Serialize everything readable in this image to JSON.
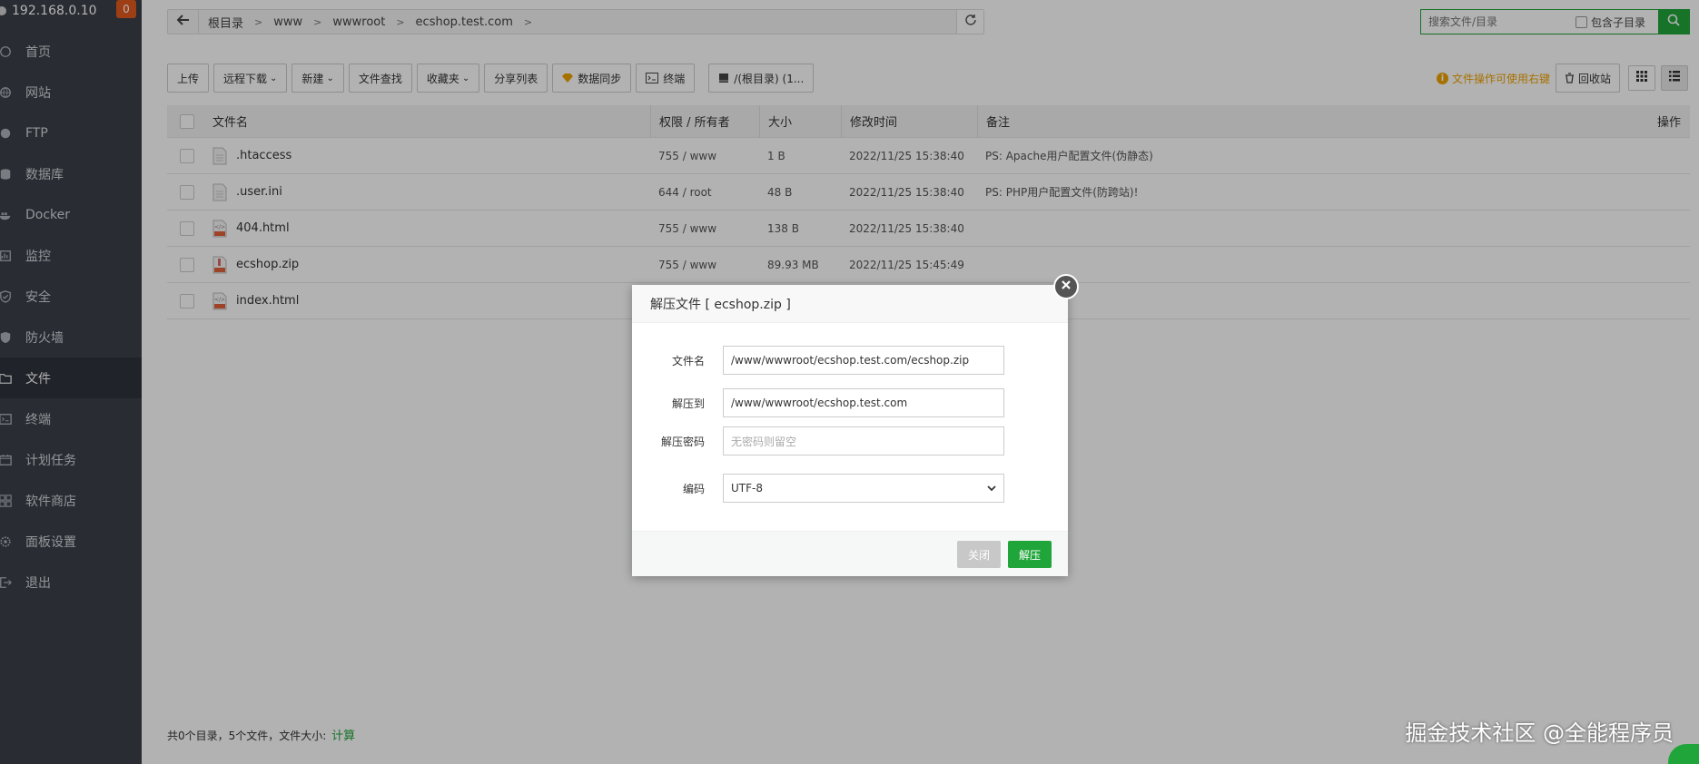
{
  "sidebar": {
    "host": "192.168.0.10",
    "badge": "0",
    "items": [
      {
        "label": "首页",
        "icon": "home-icon"
      },
      {
        "label": "网站",
        "icon": "globe-icon"
      },
      {
        "label": "FTP",
        "icon": "ftp-icon"
      },
      {
        "label": "数据库",
        "icon": "database-icon"
      },
      {
        "label": "Docker",
        "icon": "docker-icon"
      },
      {
        "label": "监控",
        "icon": "monitor-icon"
      },
      {
        "label": "安全",
        "icon": "shield-icon"
      },
      {
        "label": "防火墙",
        "icon": "firewall-icon"
      },
      {
        "label": "文件",
        "icon": "folder-icon",
        "active": true
      },
      {
        "label": "终端",
        "icon": "terminal-icon"
      },
      {
        "label": "计划任务",
        "icon": "calendar-icon"
      },
      {
        "label": "软件商店",
        "icon": "grid-icon"
      },
      {
        "label": "面板设置",
        "icon": "gear-icon"
      },
      {
        "label": "退出",
        "icon": "logout-icon"
      }
    ]
  },
  "path": {
    "crumbs": [
      "根目录",
      "www",
      "wwwroot",
      "ecshop.test.com"
    ]
  },
  "search": {
    "placeholder": "搜索文件/目录",
    "include_sub": "包含子目录"
  },
  "toolbar": {
    "upload": "上传",
    "remote_download": "远程下载",
    "new": "新建",
    "find": "文件查找",
    "favorites": "收藏夹",
    "share_list": "分享列表",
    "sync": "数据同步",
    "terminal": "终端",
    "root_path": "/(根目录) (1..."
  },
  "tip": "文件操作可使用右键",
  "recycle": "回收站",
  "table": {
    "headers": {
      "name": "文件名",
      "perm": "权限 / 所有者",
      "size": "大小",
      "mtime": "修改时间",
      "note": "备注",
      "op": "操作"
    },
    "rows": [
      {
        "name": ".htaccess",
        "perm": "755 / www",
        "size": "1 B",
        "mtime": "2022/11/25 15:38:40",
        "note": "PS: Apache用户配置文件(伪静态)"
      },
      {
        "name": ".user.ini",
        "perm": "644 / root",
        "size": "48 B",
        "mtime": "2022/11/25 15:38:40",
        "note": "PS: PHP用户配置文件(防跨站)!"
      },
      {
        "name": "404.html",
        "perm": "755 / www",
        "size": "138 B",
        "mtime": "2022/11/25 15:38:40",
        "note": ""
      },
      {
        "name": "ecshop.zip",
        "perm": "755 / www",
        "size": "89.93 MB",
        "mtime": "2022/11/25 15:45:49",
        "note": ""
      },
      {
        "name": "index.html",
        "perm": "",
        "size": "",
        "mtime": "",
        "note": ""
      }
    ]
  },
  "footer": {
    "summary": "共0个目录，5个文件，文件大小:",
    "calc": "计算"
  },
  "dialog": {
    "title": "解压文件 [ ecshop.zip ]",
    "filename_label": "文件名",
    "filename_value": "/www/wwwroot/ecshop.test.com/ecshop.zip",
    "dest_label": "解压到",
    "dest_value": "/www/wwwroot/ecshop.test.com",
    "password_label": "解压密码",
    "password_placeholder": "无密码则留空",
    "encoding_label": "编码",
    "encoding_value": "UTF-8",
    "close_label": "关闭",
    "ok_label": "解压"
  },
  "watermark": "掘金技术社区 @全能程序员",
  "colors": {
    "accent": "#20a53a",
    "sidebar": "#3b4049",
    "badge": "#e25a1e",
    "tip": "#f0a300"
  }
}
